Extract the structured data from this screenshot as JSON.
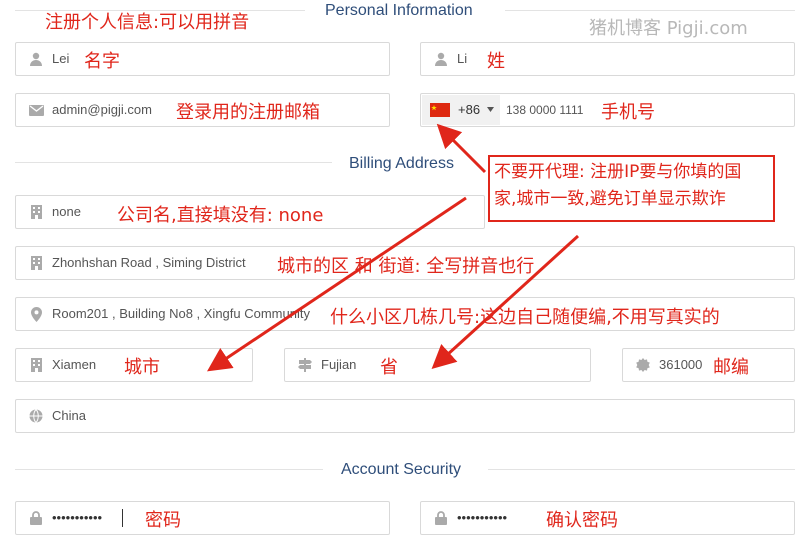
{
  "sections": {
    "personal": "Personal Information",
    "billing": "Billing Address",
    "security": "Account Security"
  },
  "watermark": "猪机博客 Pigji.com",
  "fields": {
    "first_name": "Lei",
    "last_name": "Li",
    "email": "admin@pigji.com",
    "phone_code": "+86",
    "phone": "138 0000 1111",
    "company": "none",
    "address1": "Zhonhshan Road , Siming District",
    "address2": "Room201 , Building No8 , Xingfu Community",
    "city": "Xiamen",
    "state": "Fujian",
    "postcode": "361000",
    "country": "China",
    "password": "•••••••••••",
    "password_confirm": "•••••••••••"
  },
  "notes": {
    "header": "注册个人信息:可以用拼音",
    "first_name": "名字",
    "last_name": "姓",
    "email": "登录用的注册邮箱",
    "phone": "手机号",
    "company": "公司名,直接填没有: none",
    "address1": "城市的区 和 街道: 全写拼音也行",
    "address2": "什么小区几栋几号:这边自己随便编,不用写真实的",
    "city": "城市",
    "state": "省",
    "postcode": "邮编",
    "password": "密码",
    "password_confirm": "确认密码",
    "callout_line1": "不要开代理: 注册IP要与你填的国",
    "callout_line2": "家,城市一致,避免订单显示欺诈"
  },
  "colors": {
    "annotation": "#e0261b",
    "section_title": "#2f4e7a",
    "border": "#d9d9d9"
  }
}
